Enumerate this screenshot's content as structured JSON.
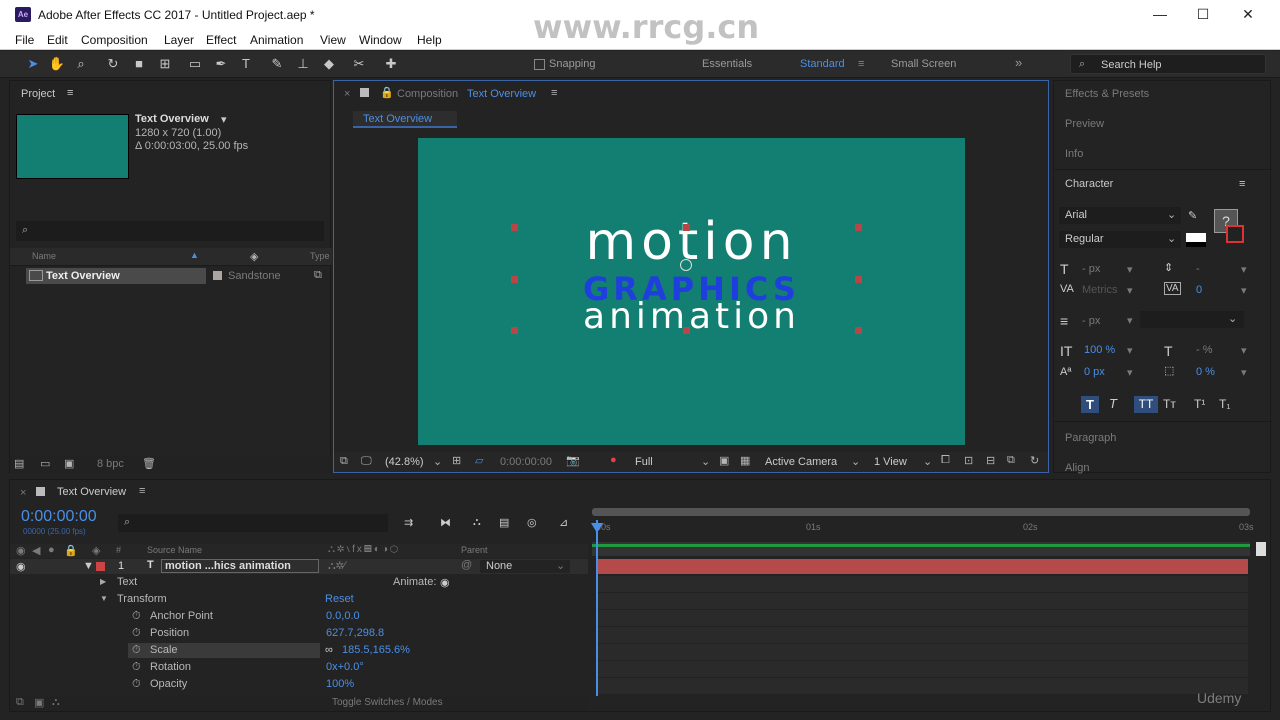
{
  "window": {
    "title": "Adobe After Effects CC 2017 - Untitled Project.aep *",
    "app_icon": "Ae"
  },
  "menu": [
    "File",
    "Edit",
    "Composition",
    "Layer",
    "Effect",
    "Animation",
    "View",
    "Window",
    "Help"
  ],
  "toolbar": {
    "snapping": "Snapping",
    "workspaces": [
      "Essentials",
      "Standard",
      "Small Screen"
    ],
    "active_workspace": "Standard",
    "search_help": "Search Help"
  },
  "project": {
    "title": "Project",
    "item_name": "Text Overview",
    "item_info1": "1280 x 720 (1.00)",
    "item_info2": "Δ 0:00:03:00, 25.00 fps",
    "col_name": "Name",
    "col_type": "Type",
    "row_name": "Text Overview",
    "row_label": "Sandstone",
    "bpc": "8 bpc"
  },
  "composition": {
    "header_prefix": "Composition",
    "header_name": "Text Overview",
    "tab": "Text Overview",
    "line1": "motion",
    "line2": "GRAPHICS",
    "line3": "animation",
    "bg_color": "#137f73",
    "zoom": "(42.8%)",
    "timecode": "0:00:00:00",
    "resolution": "Full",
    "camera": "Active Camera",
    "views": "1 View"
  },
  "right_panels": {
    "effects": "Effects & Presets",
    "preview": "Preview",
    "info": "Info",
    "character": "Character",
    "font": "Arial",
    "style": "Regular",
    "size": "- px",
    "tracking_label": "Metrics",
    "leading": "-",
    "tracking": "0",
    "stroke": "- px",
    "vscale": "100 %",
    "hscale": "- %",
    "baseline": "0 px",
    "tsume": "0 %",
    "paragraph": "Paragraph",
    "align": "Align"
  },
  "timeline": {
    "tab": "Text Overview",
    "timecode": "0:00:00:00",
    "fps_sub": "00000 (25.00 fps)",
    "col_source": "Source Name",
    "col_parent": "Parent",
    "layer_num": "1",
    "layer_name": "motion ...hics animation",
    "parent_val": "None",
    "text": "Text",
    "animate": "Animate:",
    "transform": "Transform",
    "reset": "Reset",
    "props": [
      {
        "name": "Anchor Point",
        "value": "0.0,0.0"
      },
      {
        "name": "Position",
        "value": "627.7,298.8"
      },
      {
        "name": "Scale",
        "value": "185.5,165.6%"
      },
      {
        "name": "Rotation",
        "value": "0x+0.0°"
      },
      {
        "name": "Opacity",
        "value": "100%"
      }
    ],
    "toggle": "Toggle Switches / Modes",
    "ruler": [
      "00s",
      "01s",
      "02s",
      "03s"
    ]
  },
  "watermark": {
    "site": "www.rrcg.cn",
    "brand": "Udemy"
  }
}
